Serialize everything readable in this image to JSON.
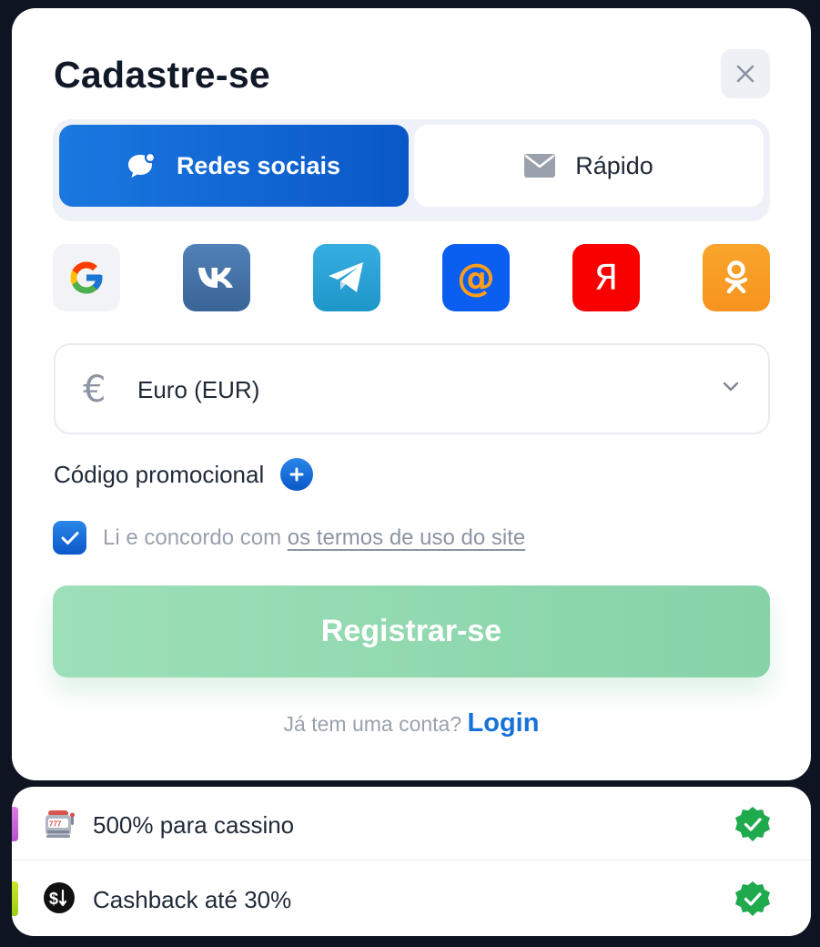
{
  "modal": {
    "title": "Cadastre-se",
    "tabs": [
      {
        "label": "Redes sociais",
        "icon": "chat-bubble-icon",
        "active": true
      },
      {
        "label": "Rápido",
        "icon": "envelope-icon",
        "active": false
      }
    ],
    "social_providers": [
      {
        "name": "google",
        "icon": "google-icon",
        "color": "#f1f3f6"
      },
      {
        "name": "vk",
        "icon": "vk-icon",
        "color": "#4a76a8"
      },
      {
        "name": "telegram",
        "icon": "telegram-icon",
        "color": "#2aa3dd"
      },
      {
        "name": "mail",
        "icon": "at-sign-icon",
        "color": "#0a5ff0"
      },
      {
        "name": "yandex",
        "icon": "yandex-icon",
        "color": "#f90000"
      },
      {
        "name": "odnoklassniki",
        "icon": "ok-icon",
        "color": "#f7931e"
      }
    ],
    "currency": {
      "symbol": "€",
      "value": "Euro (EUR)"
    },
    "promo_label": "Código promocional",
    "terms": {
      "checked": true,
      "text": "Li e concordo com",
      "link": "os termos de uso do site"
    },
    "register_label": "Registrar-se",
    "login_prompt": "Já tem uma conta?",
    "login_link": "Login"
  },
  "bonuses": [
    {
      "icon": "slot-machine-icon",
      "text": "500% para cassino",
      "accent": "#d66be0"
    },
    {
      "icon": "dollar-exchange-icon",
      "text": "Cashback até 30%",
      "accent": "#b6dc1e"
    }
  ],
  "colors": {
    "primary": "#0a58c8",
    "register_disabled": "#8fd8ae",
    "link": "#1672d8",
    "verified_green": "#1faa4e"
  }
}
